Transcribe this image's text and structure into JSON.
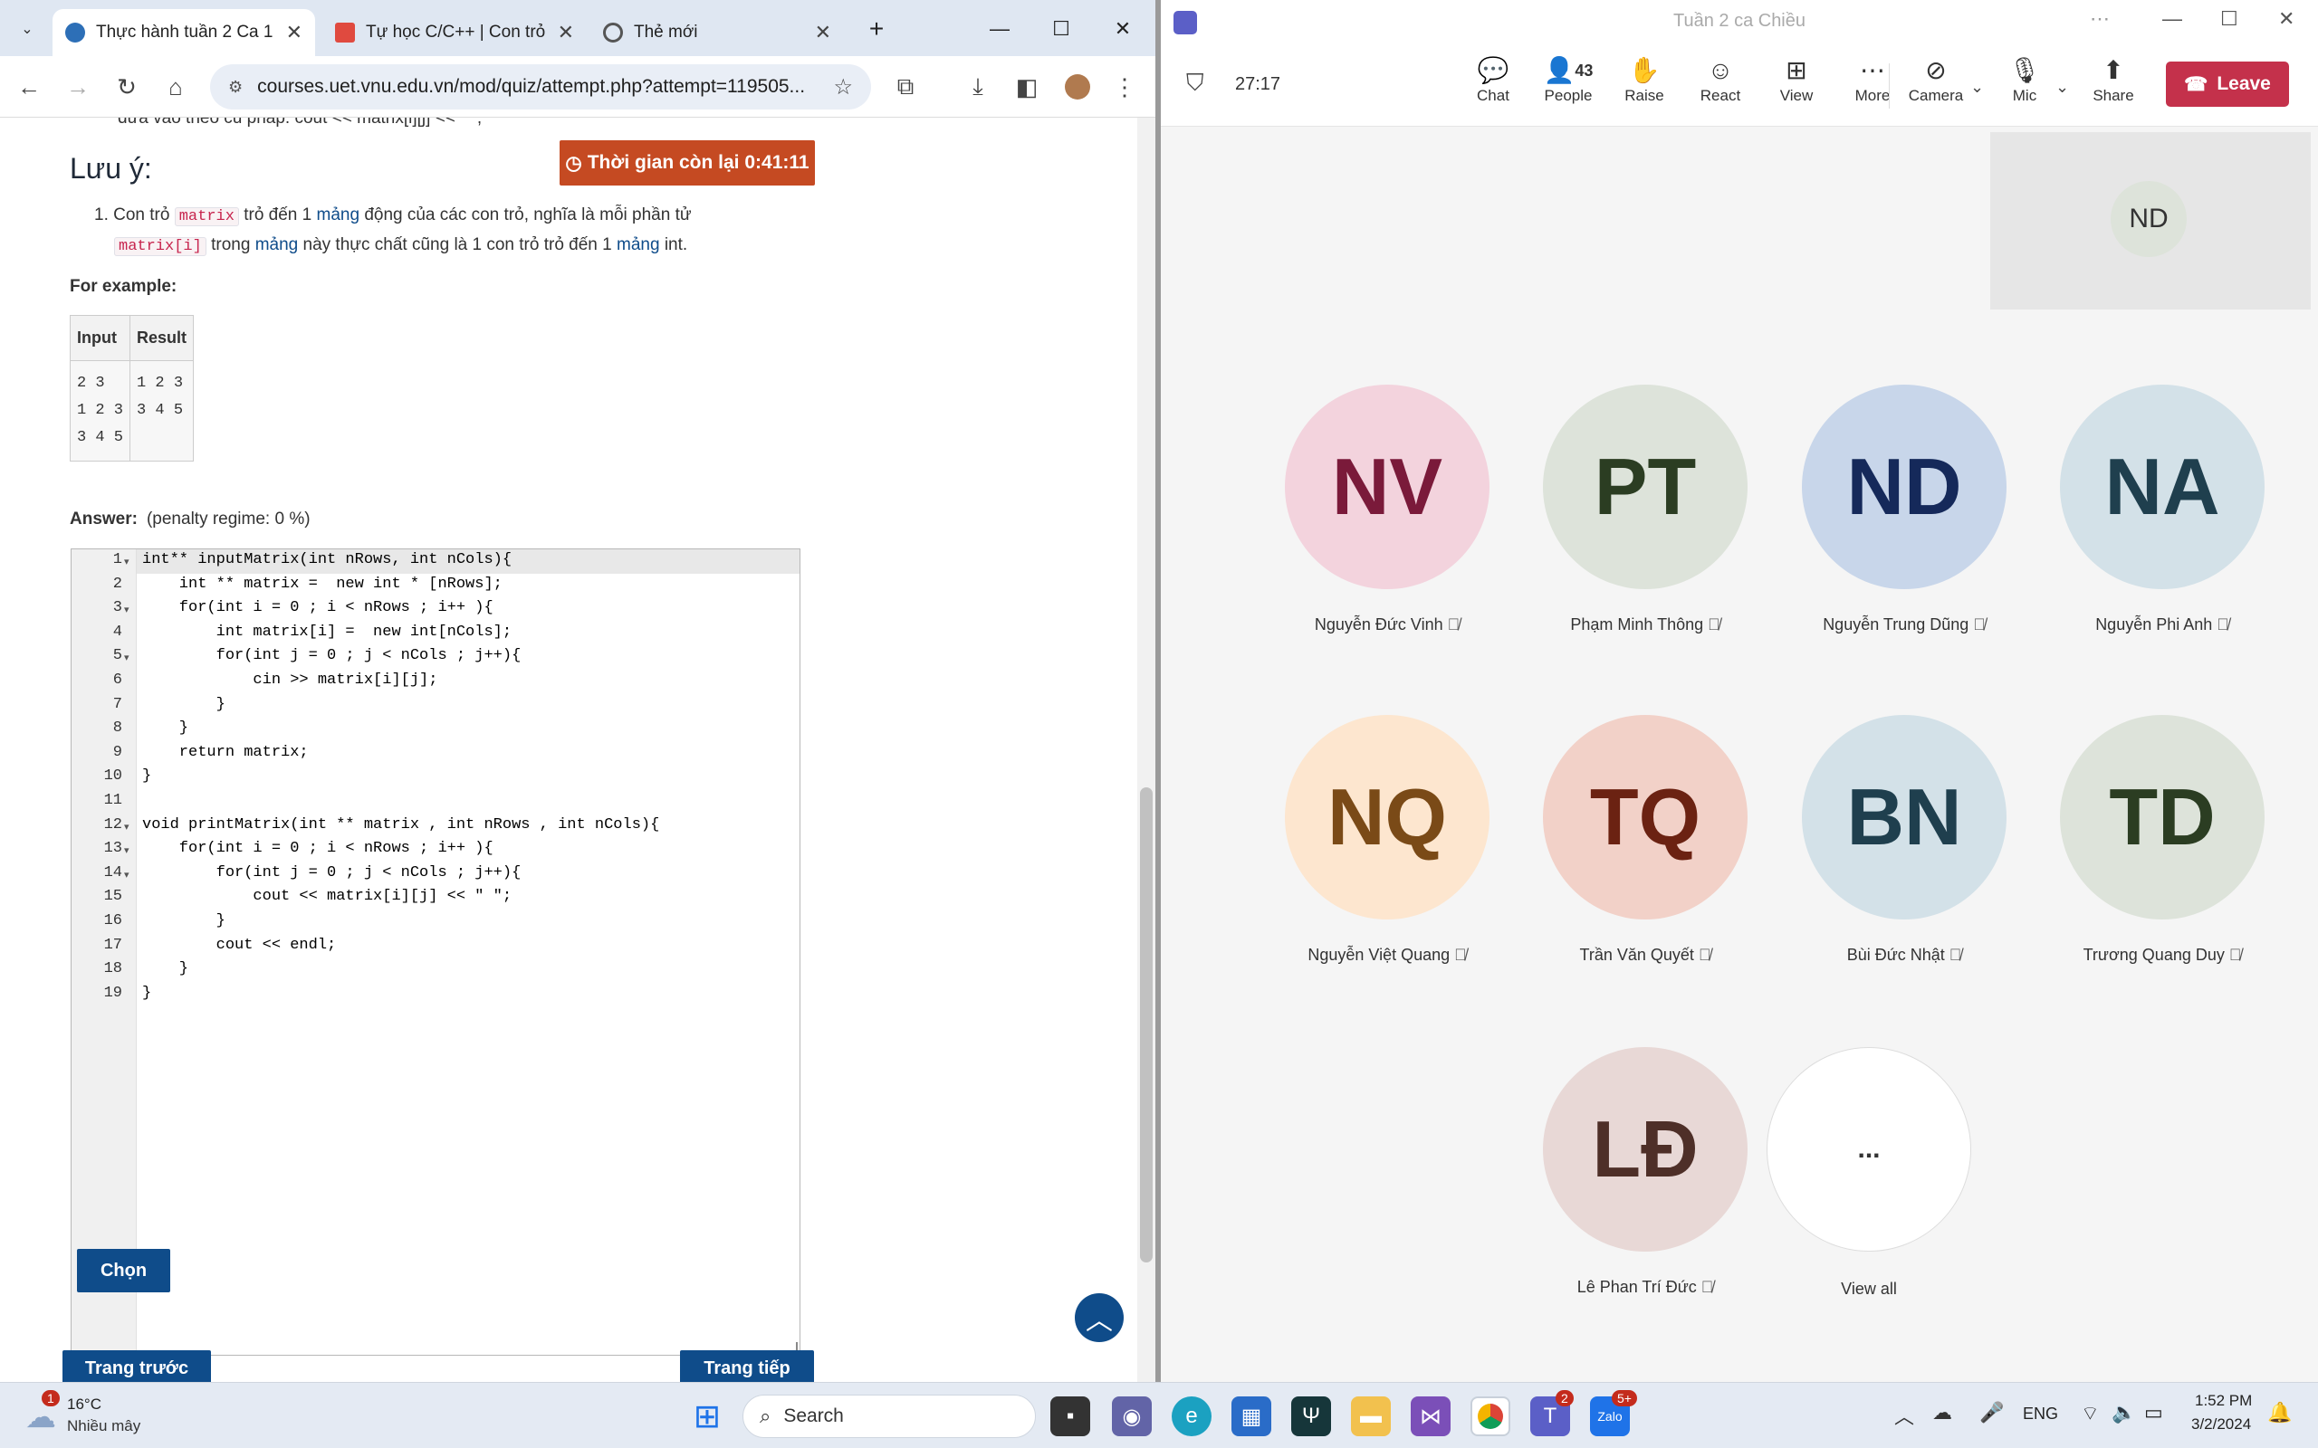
{
  "browser": {
    "tabs": [
      {
        "title": "Thực hành tuần 2 Ca 1",
        "active": true
      },
      {
        "title": "Tự học C/C++ | Con trỏ",
        "active": false
      },
      {
        "title": "Thẻ mới",
        "active": false
      }
    ],
    "url": "courses.uet.vnu.edu.vn/mod/quiz/attempt.php?attempt=119505..."
  },
  "quiz": {
    "partial_line": "đưa vào theo cú pháp:  cout << matrix[i][j] << \" \";",
    "note_title": "Lưu ý:",
    "timer": "Thời gian còn lại 0:41:11",
    "note_parts": {
      "a": "1. Con trỏ",
      "code1": "matrix",
      "b": "trỏ đến 1",
      "lk": "mảng",
      "c": "động của các con trỏ, nghĩa là mỗi phần tử",
      "code2": "matrix[i]",
      "d": "trong",
      "e": "này thực chất cũng là 1 con trỏ trỏ đến 1",
      "f": "int."
    },
    "for_example": "For example:",
    "table": {
      "headers": [
        "Input",
        "Result"
      ],
      "input": "2 3\n1 2 3\n3 4 5",
      "result": "1 2 3\n3 4 5"
    },
    "answer_label": "Answer:",
    "penalty": "(penalty regime: 0 %)",
    "code_lines": [
      "int** inputMatrix(int nRows, int nCols){",
      "    int ** matrix =  new int * [nRows];",
      "    for(int i = 0 ; i < nRows ; i++ ){",
      "        int matrix[i] =  new int[nCols];",
      "        for(int j = 0 ; j < nCols ; j++){",
      "            cin >> matrix[i][j];",
      "        }",
      "    }",
      "    return matrix;",
      "}",
      "",
      "void printMatrix(int ** matrix , int nRows , int nCols){",
      "    for(int i = 0 ; i < nRows ; i++ ){",
      "        for(int j = 0 ; j < nCols ; j++){",
      "            cout << matrix[i][j] << \" \";",
      "        }",
      "        cout << endl;",
      "    }",
      "}"
    ],
    "buttons": {
      "choose": "Chọn",
      "prev": "Trang trước",
      "next": "Trang tiếp"
    }
  },
  "teams": {
    "window_title": "Tuần 2 ca Chiều",
    "timer": "27:17",
    "toolbar": [
      {
        "label": "Chat",
        "icon": "chat-icon"
      },
      {
        "label": "People",
        "icon": "people-icon",
        "count": "43"
      },
      {
        "label": "Raise",
        "icon": "hand-icon"
      },
      {
        "label": "React",
        "icon": "smiley-icon"
      },
      {
        "label": "View",
        "icon": "grid-icon"
      },
      {
        "label": "More",
        "icon": "more-icon"
      },
      {
        "label": "Camera",
        "icon": "camera-off-icon"
      },
      {
        "label": "Mic",
        "icon": "mic-off-icon"
      },
      {
        "label": "Share",
        "icon": "share-icon"
      }
    ],
    "leave": "Leave",
    "self_initials": "ND",
    "participants": [
      {
        "initials": "NV",
        "name": "Nguyễn Đức Vinh",
        "bg": "#f3d3dd",
        "fg": "#7a1a3a"
      },
      {
        "initials": "PT",
        "name": "Phạm Minh Thông",
        "bg": "#dde3da",
        "fg": "#2b3d22"
      },
      {
        "initials": "ND",
        "name": "Nguyễn Trung Dũng",
        "bg": "#c8d6ea",
        "fg": "#15295a"
      },
      {
        "initials": "NA",
        "name": "Nguyễn Phi Anh",
        "bg": "#d3e1e8",
        "fg": "#1f3f4e"
      },
      {
        "initials": "NQ",
        "name": "Nguyễn Việt Quang",
        "bg": "#fde6cf",
        "fg": "#7a4a17"
      },
      {
        "initials": "TQ",
        "name": "Trần Văn Quyết",
        "bg": "#f2d1c8",
        "fg": "#6b2212"
      },
      {
        "initials": "BN",
        "name": "Bùi Đức Nhật",
        "bg": "#d3e1e8",
        "fg": "#1f3f4e"
      },
      {
        "initials": "TD",
        "name": "Trương Quang Duy",
        "bg": "#dde3da",
        "fg": "#2b3d22"
      },
      {
        "initials": "LĐ",
        "name": "Lê Phan Trí Đức",
        "bg": "#e8d8d6",
        "fg": "#4e2f28"
      }
    ],
    "view_all": "View all",
    "view_all_glyph": "..."
  },
  "taskbar": {
    "weather_temp": "16°C",
    "weather_desc": "Nhiều mây",
    "weather_badge": "1",
    "search": "Search",
    "teams_badge": "2",
    "zalo_badge": "5+",
    "lang": "ENG",
    "time": "1:52 PM",
    "date": "3/2/2024"
  }
}
